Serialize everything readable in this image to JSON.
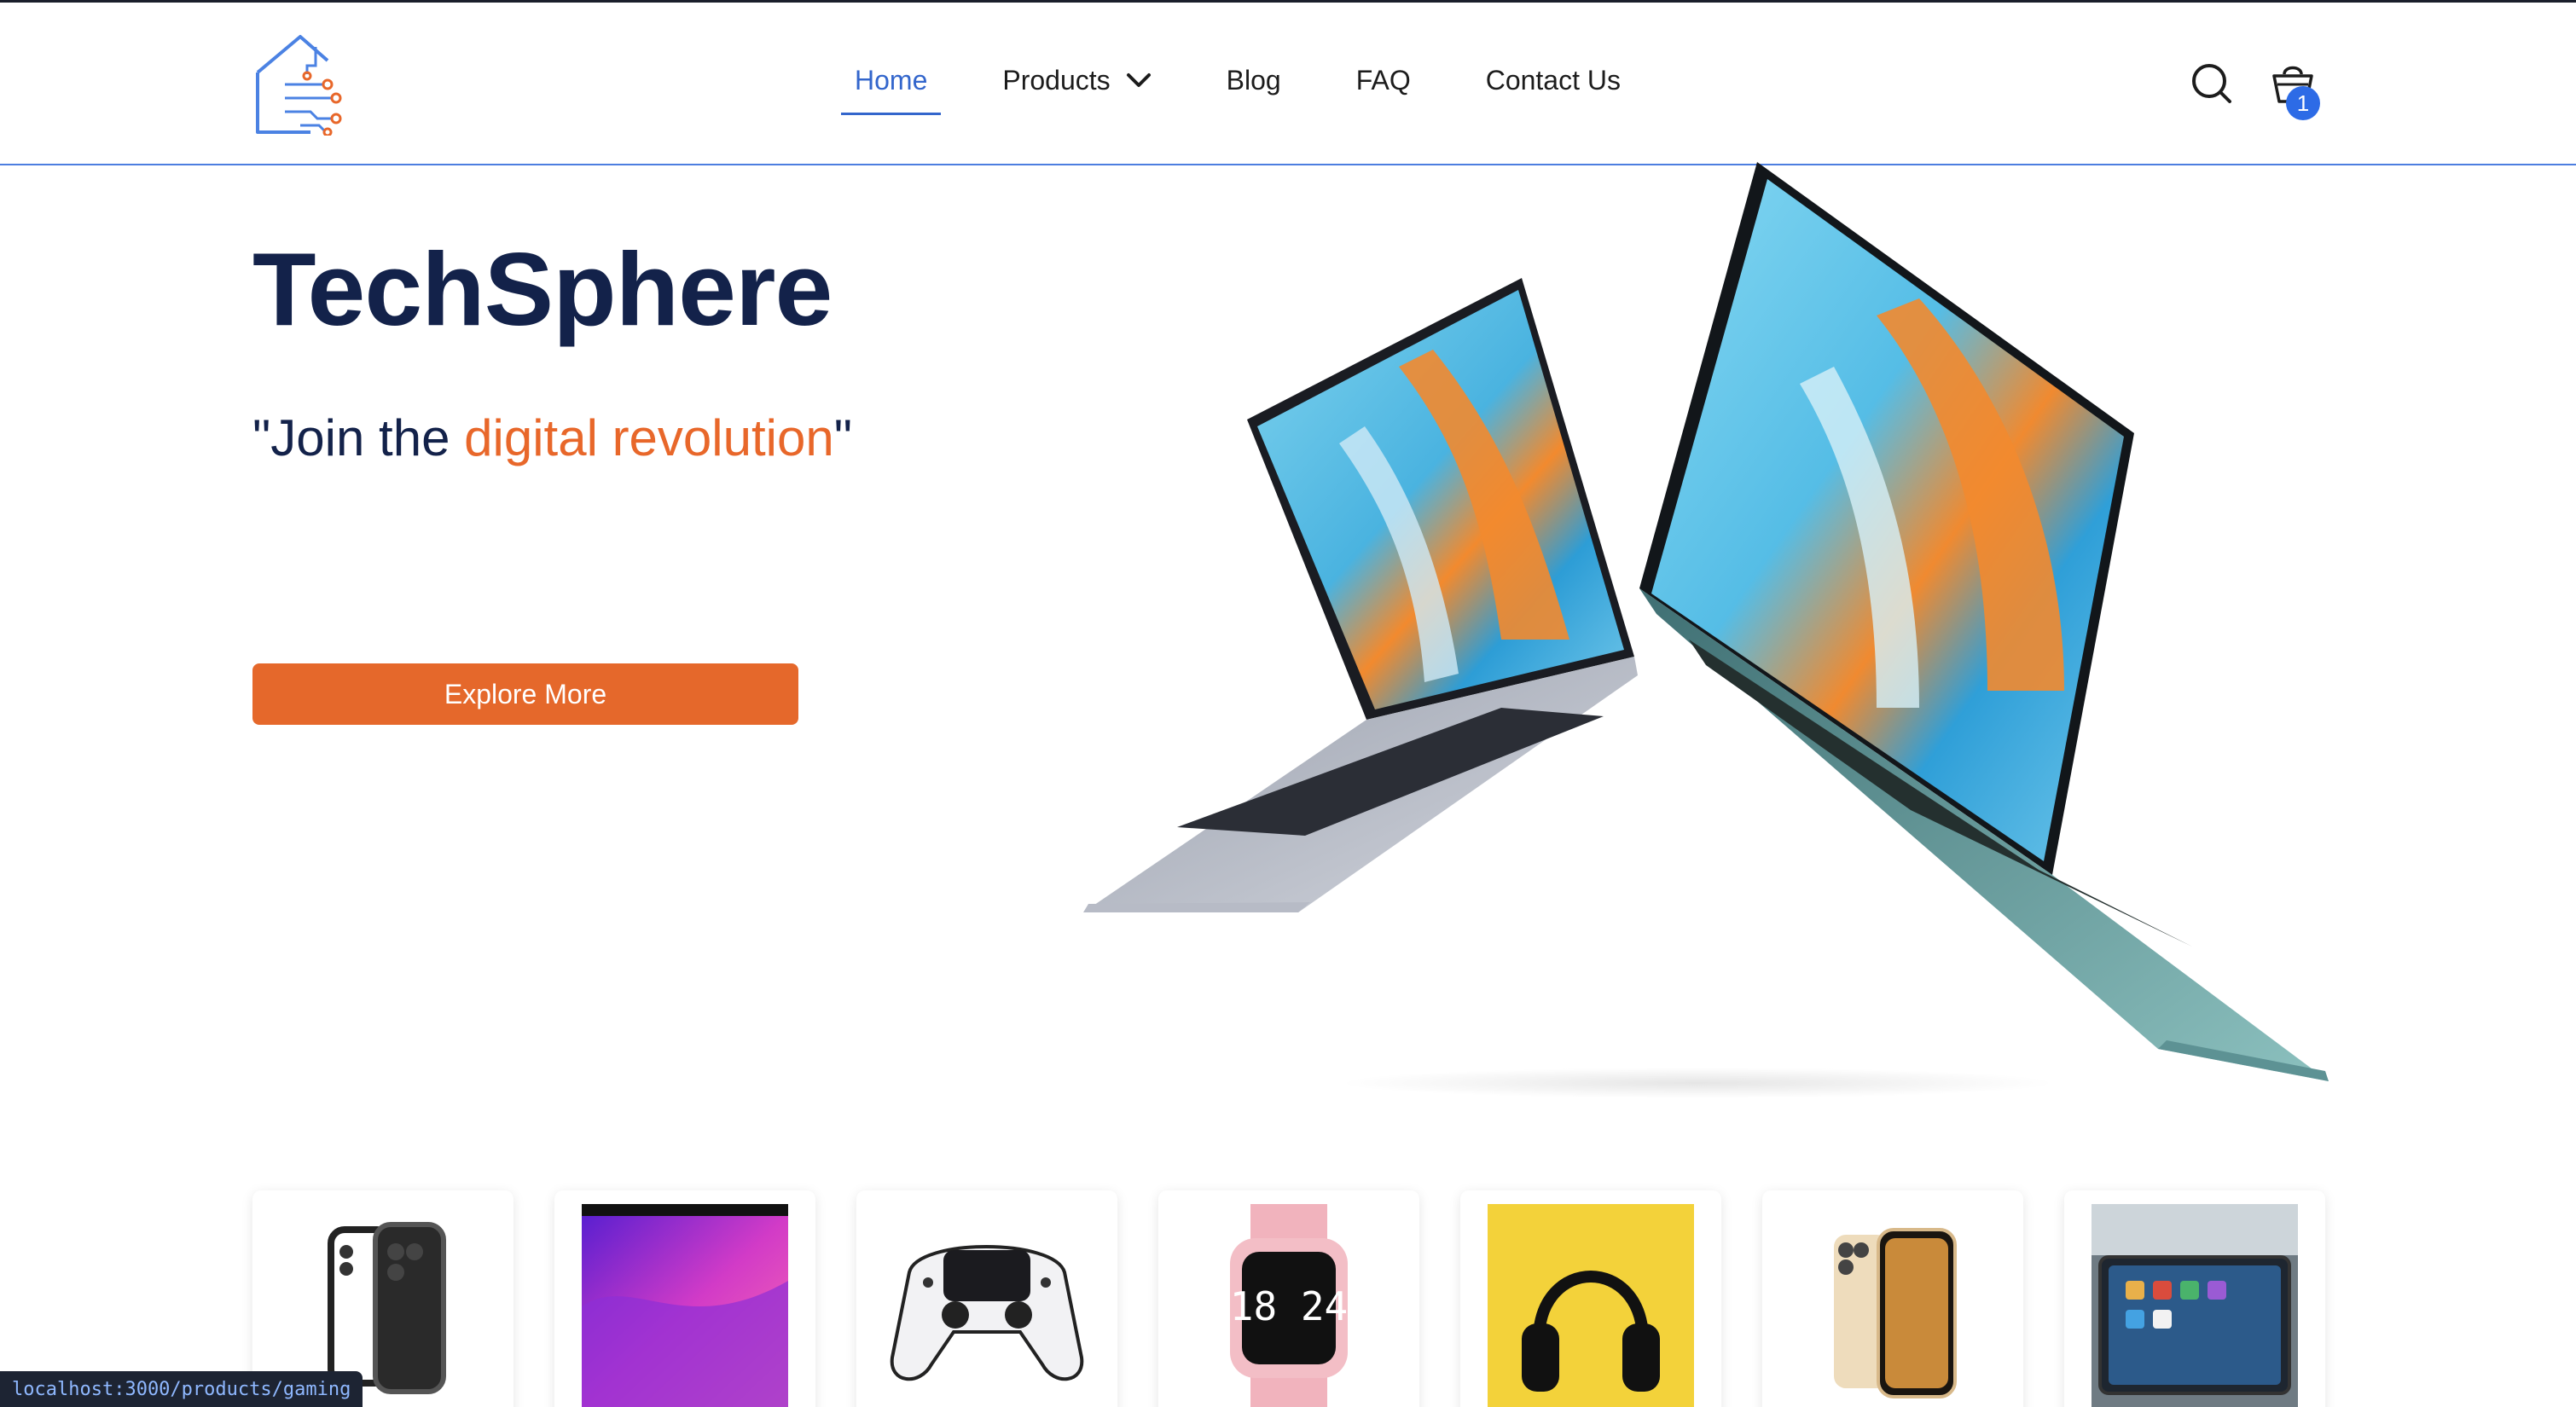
{
  "header": {
    "logo_icon": "circuit-house-logo-icon",
    "nav": [
      {
        "label": "Home",
        "active": true
      },
      {
        "label": "Products",
        "has_dropdown": true,
        "dropdown_icon": "chevron-down-icon"
      },
      {
        "label": "Blog"
      },
      {
        "label": "FAQ"
      },
      {
        "label": "Contact Us"
      }
    ],
    "search_icon": "search-icon",
    "cart_icon": "shopping-basket-icon",
    "cart_count": "1"
  },
  "hero": {
    "title": "TechSphere",
    "tagline_open": "\"Join the ",
    "tagline_accent": "digital revolution",
    "tagline_close": "\"",
    "cta_label": "Explore More",
    "image": "floating-laptops-image"
  },
  "product_cards": [
    {
      "image": "iphone-cases-image"
    },
    {
      "image": "macbook-image"
    },
    {
      "image": "gamepad-controller-image"
    },
    {
      "image": "pink-smartwatch-image"
    },
    {
      "image": "headphones-image"
    },
    {
      "image": "gold-iphone-image"
    },
    {
      "image": "tablet-image"
    }
  ],
  "status_bar": {
    "url": "localhost:3000/products/gaming"
  },
  "colors": {
    "primary_blue": "#3366cc",
    "accent_orange": "#e5682b",
    "title_navy": "#13224a",
    "badge_blue": "#2d6be6"
  }
}
